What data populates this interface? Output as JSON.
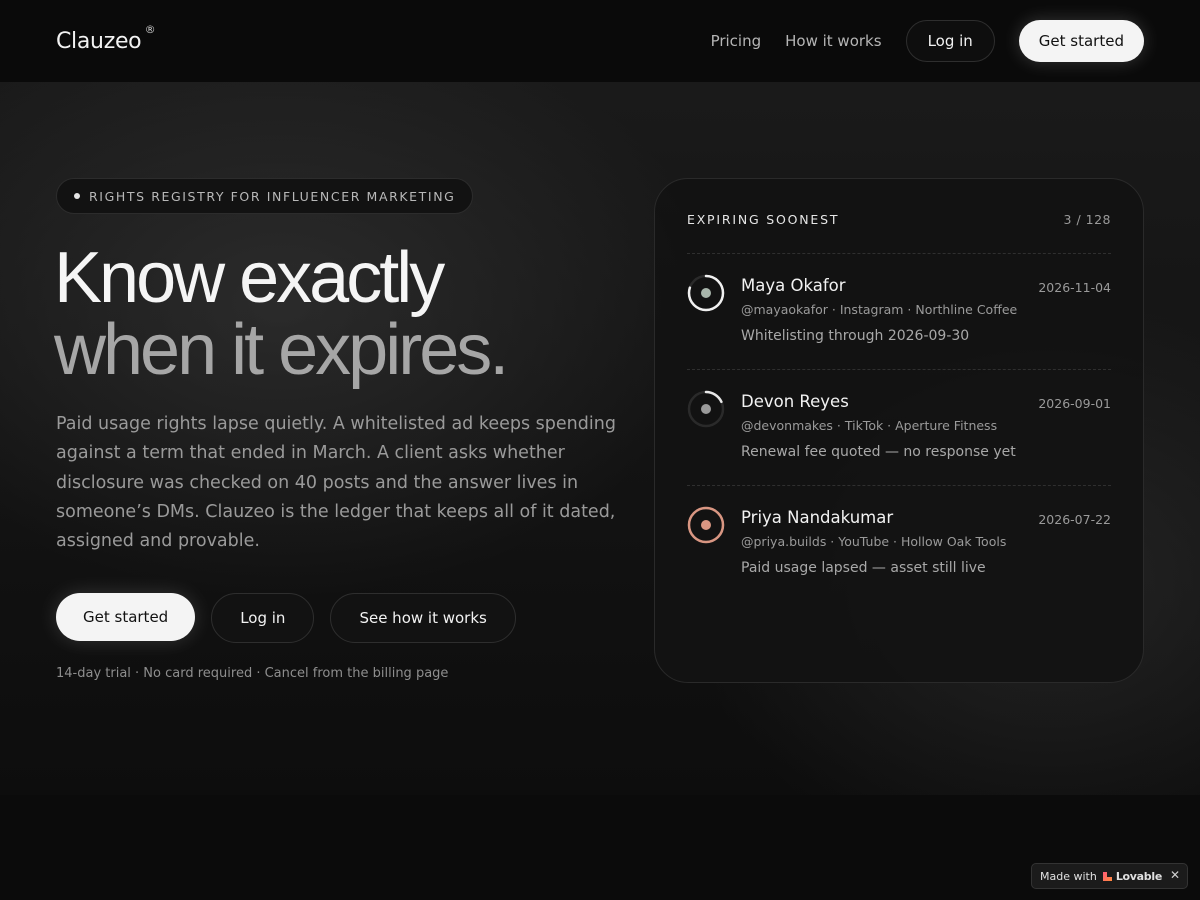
{
  "header": {
    "brand": "Clauzeo",
    "brand_mark": "®",
    "nav": [
      "Pricing",
      "How it works"
    ],
    "login_label": "Log in",
    "cta_label": "Get started"
  },
  "hero": {
    "eyebrow": "RIGHTS REGISTRY FOR INFLUENCER MARKETING",
    "headline_line1": "Know exactly",
    "headline_line2": "when it expires.",
    "lead": "Paid usage rights lapse quietly. A whitelisted ad keeps spending against a term that ended in March. A client asks whether disclosure was checked on 40 posts and the answer lives in someone’s DMs. Clauzeo is the ledger that keeps all of it dated, assigned and provable.",
    "buttons": {
      "primary": "Get started",
      "login": "Log in",
      "how": "See how it works"
    },
    "fine_print": "14-day trial · No card required · Cancel from the billing page"
  },
  "card": {
    "title": "EXPIRING SOONEST",
    "count": "3 / 128",
    "rows": [
      {
        "name": "Maya Okafor",
        "date": "2026-11-04",
        "meta": "@mayaokafor · Instagram · Northline Coffee",
        "note": "Whitelisting through 2026-09-30",
        "ring_fraction": 0.8,
        "ring_color": "#f0f0f0",
        "dot_color": "#a8b5ab"
      },
      {
        "name": "Devon Reyes",
        "date": "2026-09-01",
        "meta": "@devonmakes · TikTok · Aperture Fitness",
        "note": "Renewal fee quoted — no response yet",
        "ring_fraction": 0.18,
        "ring_color": "#e8e8e8",
        "dot_color": "#9a9a9a"
      },
      {
        "name": "Priya Nandakumar",
        "date": "2026-07-22",
        "meta": "@priya.builds · YouTube · Hollow Oak Tools",
        "note": "Paid usage lapsed — asset still live",
        "ring_fraction": 1.0,
        "ring_color": "#d99682",
        "dot_color": "#d99682"
      }
    ]
  },
  "badge": {
    "made_with": "Made with",
    "brand": "Lovable",
    "close": "✕"
  },
  "colors": {
    "background": "#0b0b0b",
    "accent_warning": "#d99682"
  }
}
